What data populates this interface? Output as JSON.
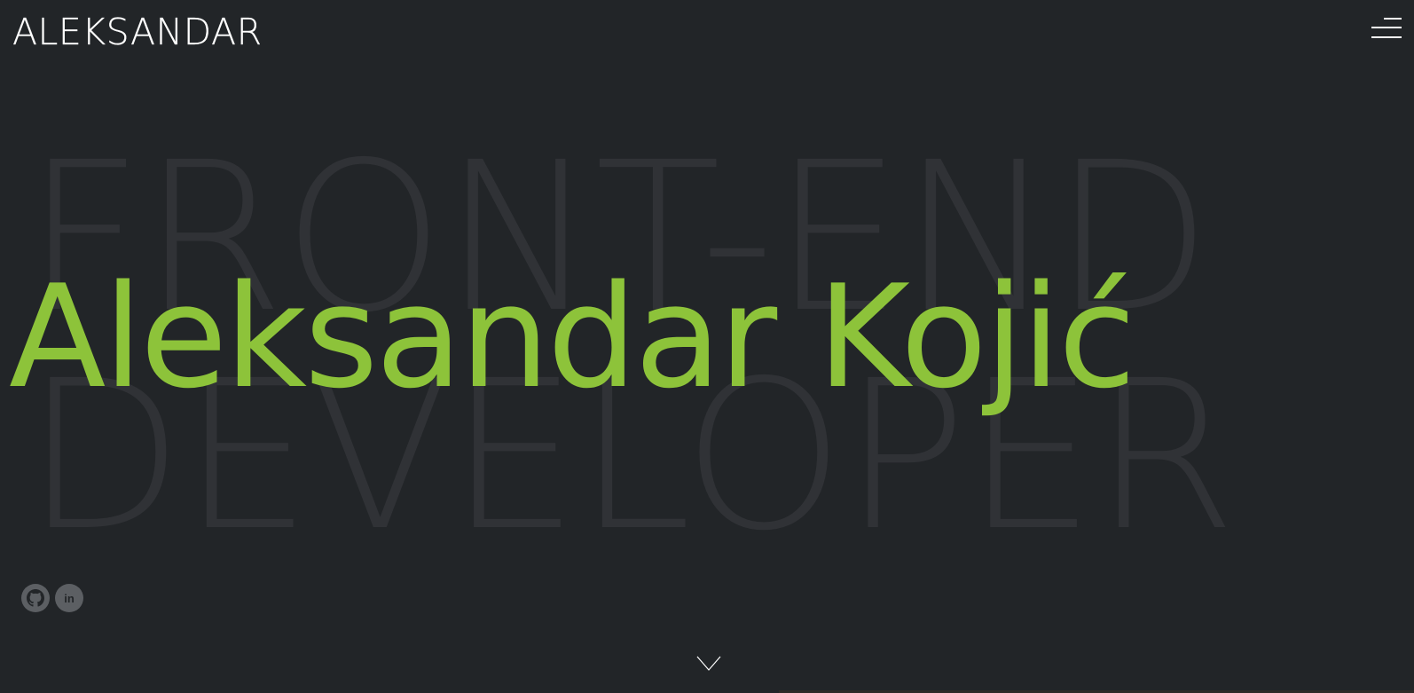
{
  "header": {
    "logo_text": "ALEKSANDAR",
    "menu_icon": "hamburger-menu-icon"
  },
  "hero": {
    "background_line_1": "FRONT-END",
    "background_line_2": "DEVELOPER",
    "name": "Aleksandar Kojić",
    "name_color": "#8dc33a",
    "background_text_color": "#303236"
  },
  "socials": [
    {
      "icon": "github-icon"
    },
    {
      "icon": "linkedin-icon",
      "label": "in"
    }
  ],
  "scroll_indicator": {
    "icon": "chevron-down-icon"
  },
  "colors": {
    "background": "#222528",
    "accent": "#8dc33a",
    "icon_circle": "#5c5f63"
  }
}
